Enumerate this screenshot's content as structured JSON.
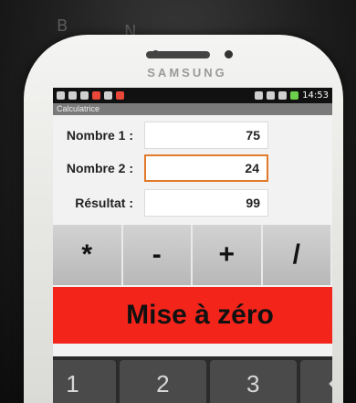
{
  "phone": {
    "brand": "SAMSUNG"
  },
  "background": {
    "laptop_keys": [
      "B",
      "N"
    ]
  },
  "status_bar": {
    "time": "14:53",
    "icons": [
      "mail-icon",
      "download-icon",
      "download-icon",
      "notification-icon",
      "image-icon",
      "notification-icon",
      "vibrate-icon",
      "bluetooth-icon",
      "signal-icon",
      "battery-icon"
    ]
  },
  "app": {
    "title": "Calculatrice",
    "fields": [
      {
        "label": "Nombre 1 :",
        "value": "75"
      },
      {
        "label": "Nombre 2 :",
        "value": "24"
      },
      {
        "label": "Résultat :",
        "value": "99"
      }
    ],
    "operators": [
      "*",
      "-",
      "+",
      "/"
    ],
    "reset_label": "Mise à zéro"
  },
  "keyboard": {
    "keys": [
      "1",
      "2",
      "3"
    ]
  },
  "colors": {
    "reset_button": "#f3251b",
    "focus_border": "#e07a2a"
  }
}
